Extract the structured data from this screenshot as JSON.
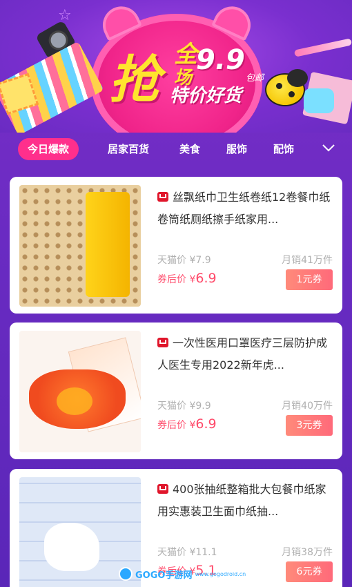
{
  "banner": {
    "big_char": "抢",
    "quan": "全",
    "chang": "场",
    "price": "9.9",
    "baoyou": "包邮",
    "tejia": "特价好货"
  },
  "tabs": [
    {
      "label": "今日爆款",
      "active": true
    },
    {
      "label": "居家百货",
      "active": false
    },
    {
      "label": "美食",
      "active": false
    },
    {
      "label": "服饰",
      "active": false
    },
    {
      "label": "配饰",
      "active": false
    }
  ],
  "products": [
    {
      "title": "丝飘纸巾卫生纸卷纸12卷餐巾纸卷筒纸厕纸擦手纸家用...",
      "tmall_price_label": "天猫价 ¥7.9",
      "sales": "月销41万件",
      "after_label": "券后价 ¥",
      "after_price": "6.9",
      "coupon": "1元券"
    },
    {
      "title": "一次性医用口罩医疗三层防护成人医生专用2022新年虎...",
      "tmall_price_label": "天猫价 ¥9.9",
      "sales": "月销40万件",
      "after_label": "券后价 ¥",
      "after_price": "6.9",
      "coupon": "3元券"
    },
    {
      "title": "400张抽纸整箱批大包餐巾纸家用实惠装卫生面巾纸抽...",
      "tmall_price_label": "天猫价 ¥11.1",
      "sales": "月销38万件",
      "after_label": "券后价 ¥",
      "after_price": "5.1",
      "coupon": "6元券"
    }
  ],
  "watermark": {
    "text": "GOGO手游网",
    "sub": "www.gogodroid.cn"
  },
  "colors": {
    "background": "#6a2bc2",
    "active_tab": "#ff2f8c",
    "price_red": "#ff4a6a",
    "coupon": "#ff6a7a",
    "tmall_red": "#e0162b"
  }
}
